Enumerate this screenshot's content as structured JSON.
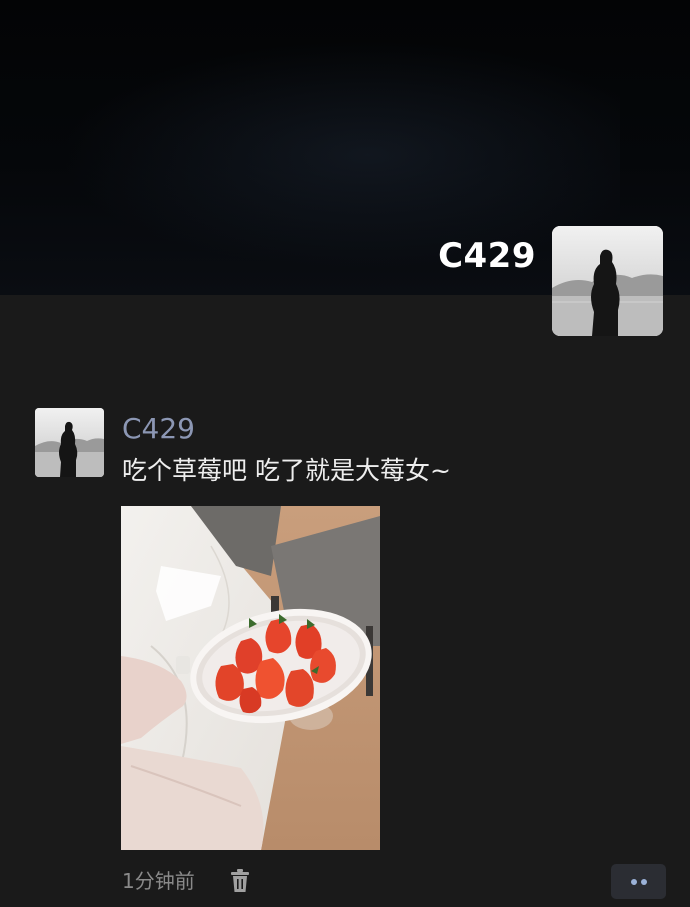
{
  "profile": {
    "cover_name": "C429",
    "cover_avatar_icon": "silhouette-avatar"
  },
  "post": {
    "author": "C429",
    "text": "吃个草莓吧 吃了就是大莓女~",
    "photo_subject": "strawberries-in-bowl",
    "time": "1分钟前",
    "delete_icon": "trash-icon",
    "more_icon": "more-dots-icon"
  },
  "colors": {
    "background": "#1a1a1a",
    "cover": "#05070a",
    "author_name": "#8c97b4",
    "post_text": "#eeeeee",
    "time": "#8a8a8a",
    "more_dots": "#9bb2d8"
  }
}
